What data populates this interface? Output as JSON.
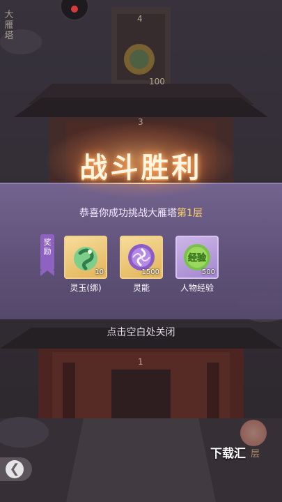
{
  "tower": {
    "name_vertical": "大雁塔",
    "floor_labels": [
      "4",
      "100",
      "3",
      "1"
    ]
  },
  "victory": {
    "title": "战斗胜利",
    "subtitle_prefix": "恭喜你成功挑战大雁塔",
    "subtitle_highlight": "第1层"
  },
  "rewards": {
    "tag": "奖励",
    "items": [
      {
        "name": "灵玉(绑)",
        "quantity": "10",
        "icon": "spirit-jade-icon",
        "frame_color": "#e8bd62"
      },
      {
        "name": "灵能",
        "quantity": "1500",
        "icon": "spirit-energy-icon",
        "frame_color": "#e8bd62"
      },
      {
        "name": "人物经验",
        "quantity": "500",
        "icon_text": "经验",
        "icon": "experience-icon",
        "frame_color": "#b896dc"
      }
    ]
  },
  "close_hint": "点击空白处关闭",
  "watermark": "下载汇",
  "corner_label": "层",
  "colors": {
    "banner": "#7a6894",
    "highlight": "#ffd36b",
    "title_glow": "#ff8a3d"
  }
}
